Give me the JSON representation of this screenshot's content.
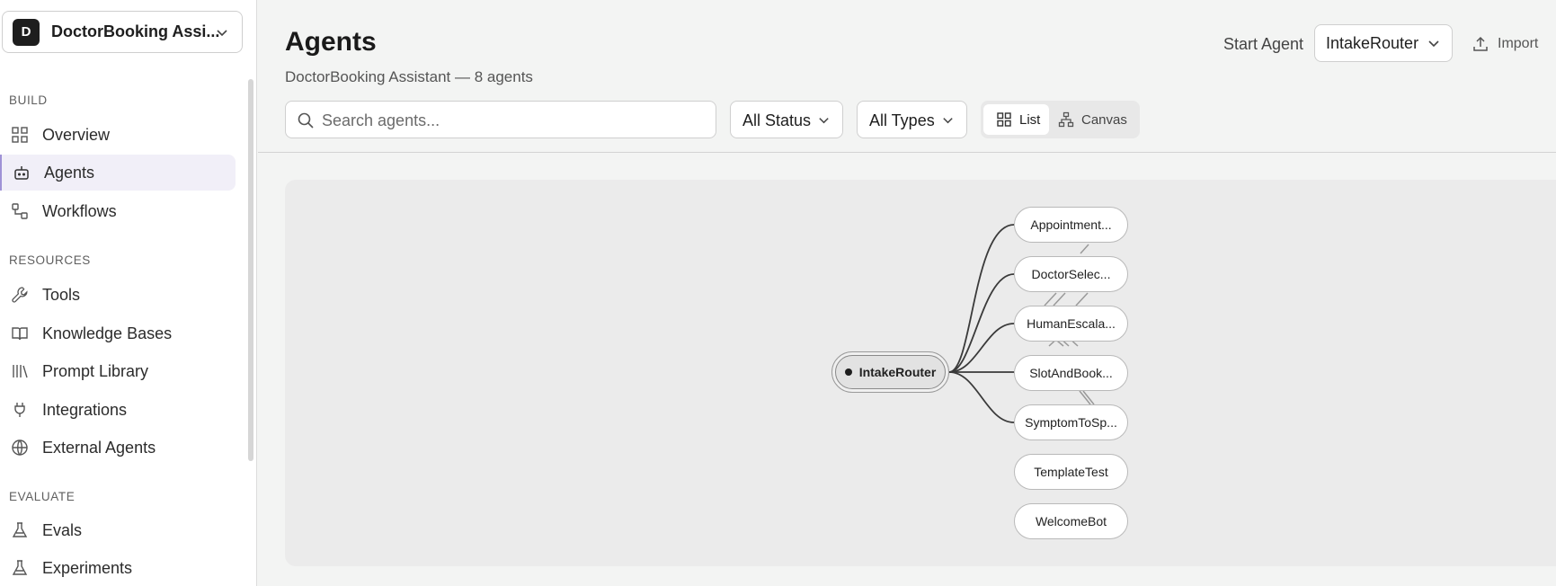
{
  "workspace": {
    "initial": "D",
    "name": "DoctorBooking Assi..."
  },
  "sidebar": {
    "sections": [
      {
        "label": "BUILD",
        "items": [
          {
            "label": "Overview",
            "icon": "grid-icon"
          },
          {
            "label": "Agents",
            "icon": "bot-icon",
            "active": true
          },
          {
            "label": "Workflows",
            "icon": "workflow-icon"
          }
        ]
      },
      {
        "label": "RESOURCES",
        "items": [
          {
            "label": "Tools",
            "icon": "wrench-icon"
          },
          {
            "label": "Knowledge Bases",
            "icon": "book-icon"
          },
          {
            "label": "Prompt Library",
            "icon": "library-icon"
          },
          {
            "label": "Integrations",
            "icon": "plug-icon"
          },
          {
            "label": "External Agents",
            "icon": "globe-icon"
          }
        ]
      },
      {
        "label": "EVALUATE",
        "items": [
          {
            "label": "Evals",
            "icon": "flask-icon"
          },
          {
            "label": "Experiments",
            "icon": "flask-icon"
          }
        ]
      }
    ]
  },
  "header": {
    "title": "Agents",
    "subtitle": "DoctorBooking Assistant — 8 agents",
    "start_agent_label": "Start Agent",
    "start_agent_value": "IntakeRouter",
    "import_label": "Import"
  },
  "toolbar": {
    "search_placeholder": "Search agents...",
    "status_filter": "All Status",
    "type_filter": "All Types",
    "view_list": "List",
    "view_canvas": "Canvas"
  },
  "canvas": {
    "root": "IntakeRouter",
    "nodes": [
      "Appointment...",
      "DoctorSelec...",
      "HumanEscala...",
      "SlotAndBook...",
      "SymptomToSp...",
      "TemplateTest",
      "WelcomeBot"
    ]
  },
  "colors": {
    "accent": "#9f92d6",
    "active_bg": "#f1eff8",
    "dark": "#1e1e1e"
  }
}
